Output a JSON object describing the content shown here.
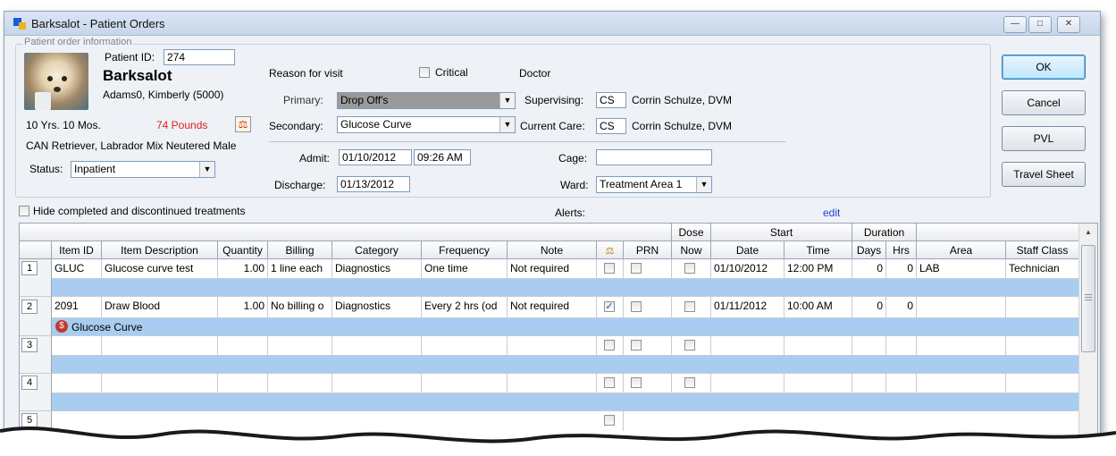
{
  "window": {
    "title": "Barksalot - Patient Orders",
    "min_label": "—",
    "max_label": "□",
    "close_label": "✕"
  },
  "patient": {
    "section_title": "Patient order information",
    "id_label": "Patient ID:",
    "id_value": "274",
    "name": "Barksalot",
    "owner": "Adams0, Kimberly  (5000)",
    "age": "10 Yrs. 10 Mos.",
    "weight": "74 Pounds",
    "breed": "CAN Retriever, Labrador Mix Neutered Male",
    "status_label": "Status:",
    "status_value": "Inpatient"
  },
  "visit": {
    "reason_label": "Reason for visit",
    "critical_label": "Critical",
    "primary_label": "Primary:",
    "primary_value": "Drop Off's",
    "secondary_label": "Secondary:",
    "secondary_value": "Glucose Curve",
    "admit_label": "Admit:",
    "admit_date": "01/10/2012",
    "admit_time": "09:26 AM",
    "discharge_label": "Discharge:",
    "discharge_date": "01/13/2012"
  },
  "doctor": {
    "doctor_label": "Doctor",
    "supervising_label": "Supervising:",
    "supervising_code": "CS",
    "supervising_name": "Corrin Schulze, DVM",
    "current_label": "Current Care:",
    "current_code": "CS",
    "current_name": "Corrin Schulze, DVM",
    "cage_label": "Cage:",
    "cage_value": "",
    "ward_label": "Ward:",
    "ward_value": "Treatment Area 1"
  },
  "buttons": {
    "ok": "OK",
    "cancel": "Cancel",
    "pvl": "PVL",
    "travel": "Travel Sheet"
  },
  "filters": {
    "hide_label": "Hide completed and discontinued treatments",
    "alerts_label": "Alerts:",
    "edit_link": "edit"
  },
  "grid": {
    "group_headers": {
      "dose": "Dose",
      "start": "Start",
      "duration": "Duration"
    },
    "columns": [
      "Item ID",
      "Item Description",
      "Quantity",
      "Billing",
      "Category",
      "Frequency",
      "Note",
      "",
      "PRN",
      "Now",
      "Date",
      "Time",
      "Days",
      "Hrs",
      "Area",
      "Staff Class"
    ],
    "rows": [
      {
        "num": "1",
        "item_id": "GLUC",
        "desc": "Glucose curve test",
        "qty": "1.00",
        "billing": "1 line each",
        "category": "Diagnostics",
        "frequency": "One time",
        "note": "Not required",
        "scale_checked": false,
        "date": "01/10/2012",
        "time": "12:00 PM",
        "days": "0",
        "hrs": "0",
        "area": "LAB",
        "staff": "Technician",
        "sub": ""
      },
      {
        "num": "2",
        "item_id": "2091",
        "desc": "Draw Blood",
        "qty": "1.00",
        "billing": "No billing o",
        "category": "Diagnostics",
        "frequency": "Every 2 hrs (od",
        "note": "Not required",
        "scale_checked": true,
        "date": "01/11/2012",
        "time": "10:00 AM",
        "days": "0",
        "hrs": "0",
        "area": "",
        "staff": "",
        "sub": "Glucose Curve"
      },
      {
        "num": "3"
      },
      {
        "num": "4"
      },
      {
        "num": "5"
      }
    ]
  },
  "colors": {
    "title_bg": "#c6d6ea",
    "row_blue": "#a8cdf0",
    "weight_red": "#e02020",
    "link_blue": "#1a3fd6"
  },
  "icons": {
    "scale": "scale-icon",
    "dollar": "no-charge-icon"
  }
}
